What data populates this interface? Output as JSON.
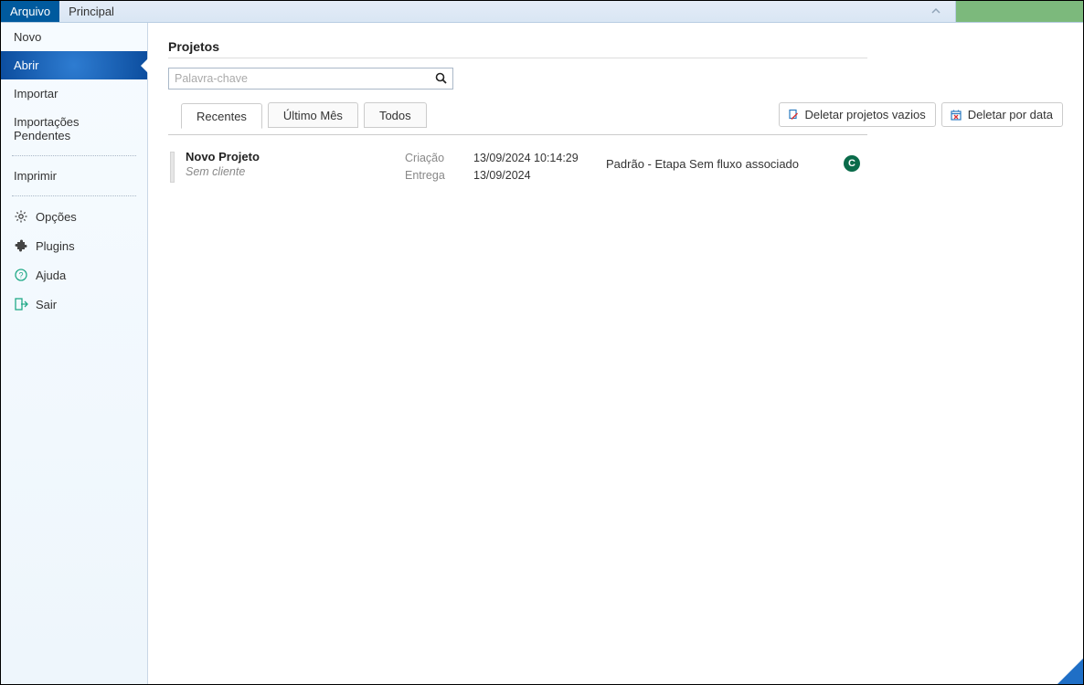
{
  "topbar": {
    "tab_active": "Arquivo",
    "tab_inactive": "Principal"
  },
  "sidebar": {
    "novo": "Novo",
    "abrir": "Abrir",
    "importar": "Importar",
    "importacoes_pendentes": "Importações Pendentes",
    "imprimir": "Imprimir",
    "opcoes": "Opções",
    "plugins": "Plugins",
    "ajuda": "Ajuda",
    "sair": "Sair"
  },
  "main": {
    "heading": "Projetos",
    "search_placeholder": "Palavra-chave",
    "tabs": {
      "recentes": "Recentes",
      "ultimo_mes": "Último Mês",
      "todos": "Todos"
    },
    "actions": {
      "delete_empty": "Deletar projetos vazios",
      "delete_by_date": "Deletar por data"
    },
    "labels": {
      "criacao": "Criação",
      "entrega": "Entrega"
    },
    "project": {
      "title": "Novo Projeto",
      "client": "Sem cliente",
      "created": "13/09/2024 10:14:29",
      "delivery": "13/09/2024",
      "status": "Padrão - Etapa Sem fluxo associado",
      "badge": "C"
    }
  }
}
